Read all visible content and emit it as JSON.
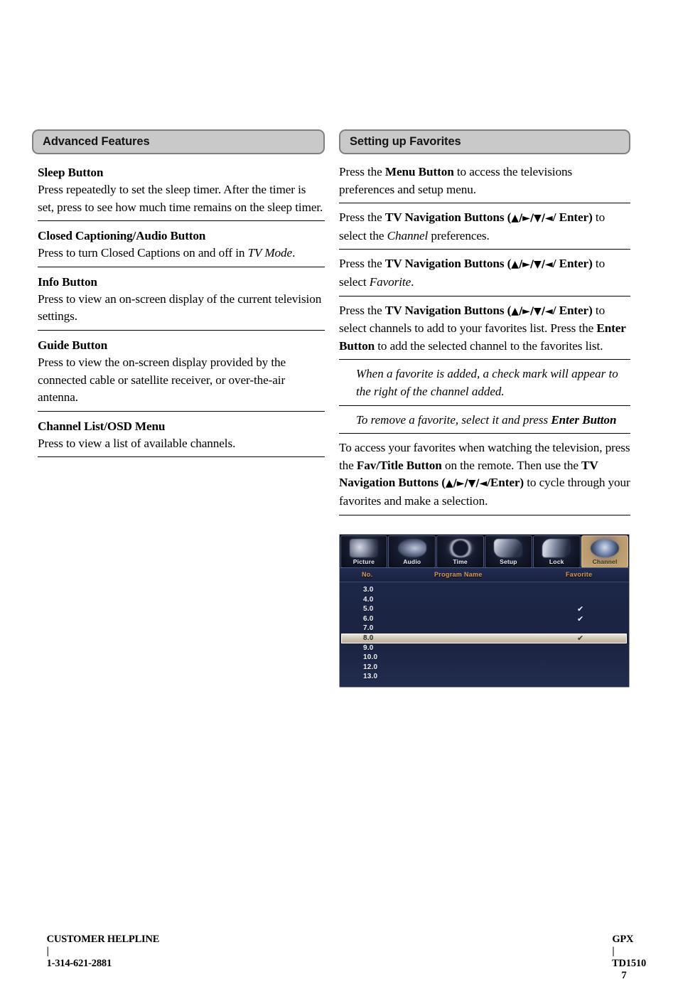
{
  "left_column": {
    "header": "Advanced Features",
    "entries": [
      {
        "title": "Sleep Button",
        "body_html": "Press repeatedly to set the sleep timer. After the timer is set, press to see how much time remains on the sleep timer."
      },
      {
        "title": "Closed Captioning/Audio Button",
        "body_html": "Press to turn Closed Captions on and off in <i>TV Mode</i>."
      },
      {
        "title": "Info Button",
        "body_html": "Press to view an on-screen display of the current television settings."
      },
      {
        "title": "Guide Button",
        "body_html": "Press to view the on-screen display provided by the connected cable or satellite receiver, or over-the-air antenna."
      },
      {
        "title": "Channel List/OSD Menu",
        "body_html": "Press to view a list of available channels."
      }
    ]
  },
  "right_column": {
    "header": "Setting up Favorites",
    "steps": [
      {
        "type": "step",
        "html": "Press the <b>Menu Button</b> to access the televisions preferences and setup menu."
      },
      {
        "type": "step",
        "html": "Press the <b>TV Navigation Buttons (<span class=\"nav\">▲/►/▼/◄</span>/ Enter)</b> to select the <i>Channel</i> preferences."
      },
      {
        "type": "step",
        "html": "Press the <b>TV Navigation Buttons (<span class=\"nav\">▲/►/▼/◄</span>/ Enter)</b> to select <i>Favorite</i>."
      },
      {
        "type": "step",
        "html": "Press the <b>TV Navigation Buttons (<span class=\"nav\">▲/►/▼/◄</span>/ Enter)</b> to select channels to add to your favorites list. Press the <b>Enter Button</b> to add the selected channel to the favorites list."
      },
      {
        "type": "note",
        "html": "When a favorite is added, a check mark will appear to the right of the channel added."
      },
      {
        "type": "note",
        "html": "To remove a favorite, select it and press <b>Enter Button</b>"
      },
      {
        "type": "step",
        "html": "To access your favorites when watching the television, press the <b>Fav/Title Button</b> on the remote. Then use the <b>TV Navigation Buttons (<span class=\"nav\">▲/►/▼/◄</span>/Enter)</b> to cycle through your favorites and make a selection."
      }
    ]
  },
  "tv_screenshot": {
    "tabs": [
      {
        "label": "Picture",
        "icon": "picture-icon",
        "selected": false
      },
      {
        "label": "Audio",
        "icon": "audio-icon",
        "selected": false
      },
      {
        "label": "Time",
        "icon": "clock-icon",
        "selected": false
      },
      {
        "label": "Setup",
        "icon": "setup-icon",
        "selected": false
      },
      {
        "label": "Lock",
        "icon": "lock-icon",
        "selected": false
      },
      {
        "label": "Channel",
        "icon": "channel-icon",
        "selected": true
      }
    ],
    "columns": {
      "no": "No.",
      "program_name": "Program Name",
      "favorite": "Favorite"
    },
    "rows": [
      {
        "no": "3.0",
        "favorite": "",
        "highlight": false
      },
      {
        "no": "4.0",
        "favorite": "",
        "highlight": false
      },
      {
        "no": "5.0",
        "favorite": "✔",
        "highlight": false
      },
      {
        "no": "6.0",
        "favorite": "✔",
        "highlight": false
      },
      {
        "no": "7.0",
        "favorite": "",
        "highlight": false
      },
      {
        "no": "8.0",
        "favorite": "✔",
        "highlight": true
      },
      {
        "no": "9.0",
        "favorite": "",
        "highlight": false
      },
      {
        "no": "10.0",
        "favorite": "",
        "highlight": false
      },
      {
        "no": "12.0",
        "favorite": "",
        "highlight": false
      },
      {
        "no": "13.0",
        "favorite": "",
        "highlight": false
      }
    ],
    "colors": {
      "panel_bg": "#1d2748",
      "header_text": "#d89a50",
      "selected_tab": "#c9a878",
      "highlight_row": "#cfc7b6"
    }
  },
  "footer": {
    "helpline_label": "CUSTOMER HELPLINE",
    "separator": "|",
    "phone": "1-314-621-2881",
    "brand": "GPX",
    "model": "TD1510",
    "page_number": "7"
  }
}
